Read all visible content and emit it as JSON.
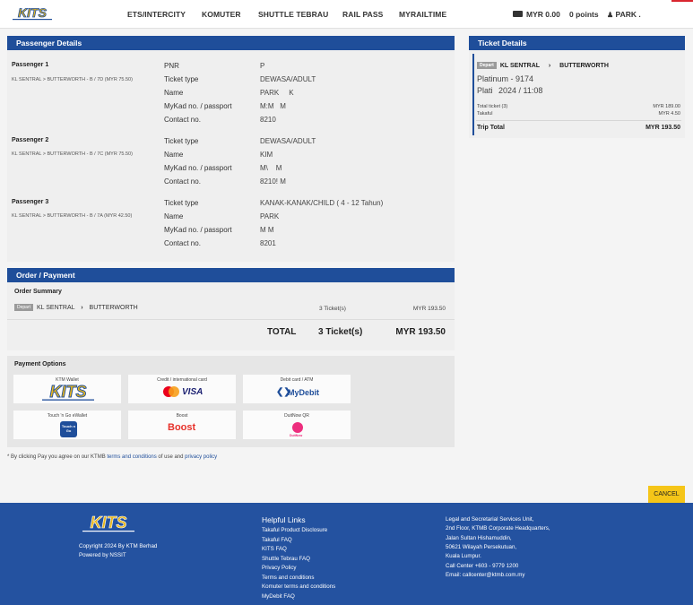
{
  "nav": {
    "logo_text": "KITS",
    "items": [
      "ETS/INTERCITY",
      "KOMUTER",
      "SHUTTLE TEBRAU",
      "RAIL PASS",
      "MYRAILTIME"
    ],
    "wallet": "MYR 0.00",
    "points": "0 points",
    "user": "PARK ."
  },
  "passenger_details": {
    "title": "Passenger Details",
    "passengers": [
      {
        "heading": "Passenger 1",
        "route": "KL SENTRAL > BUTTERWORTH - B / 7D (MYR 75.50)",
        "fields": [
          {
            "label": "PNR",
            "value": "P"
          },
          {
            "label": "Ticket type",
            "value": "DEWASA/ADULT"
          },
          {
            "label": "Name",
            "value": "PARK     K"
          },
          {
            "label": "MyKad no. / passport",
            "value": "M:M   M"
          },
          {
            "label": "Contact no.",
            "value": "8210"
          }
        ]
      },
      {
        "heading": "Passenger 2",
        "route": "KL SENTRAL > BUTTERWORTH - B / 7C (MYR 75.50)",
        "fields": [
          {
            "label": "Ticket type",
            "value": "DEWASA/ADULT"
          },
          {
            "label": "Name",
            "value": "KIM"
          },
          {
            "label": "MyKad no. / passport",
            "value": "M\\    M"
          },
          {
            "label": "Contact no.",
            "value": "8210! M"
          }
        ]
      },
      {
        "heading": "Passenger 3",
        "route": "KL SENTRAL > BUTTERWORTH - B / 7A (MYR 42.50)",
        "fields": [
          {
            "label": "Ticket type",
            "value": "KANAK-KANAK/CHILD ( 4 - 12 Tahun)"
          },
          {
            "label": "Name",
            "value": "PARK"
          },
          {
            "label": "MyKad no. / passport",
            "value": "M M"
          },
          {
            "label": "Contact no.",
            "value": "8201"
          }
        ]
      }
    ]
  },
  "order": {
    "title": "Order / Payment",
    "summary_title": "Order Summary",
    "badge": "Depart",
    "route_from": "KL SENTRAL",
    "route_to": "BUTTERWORTH",
    "line_tickets": "3 Ticket(s)",
    "line_amount": "MYR 193.50",
    "total_label": "TOTAL",
    "total_tickets": "3 Ticket(s)",
    "total_amount": "MYR 193.50"
  },
  "payment": {
    "title": "Payment Options",
    "options": [
      {
        "caption": "KTM Wallet",
        "logo": "KITS"
      },
      {
        "caption": "Credit / international card",
        "logo": "VISA"
      },
      {
        "caption": "Debit card / ATM",
        "logo": "MyDebit"
      },
      {
        "caption": "Touch 'n Go eWallet",
        "logo": "Touch n Go"
      },
      {
        "caption": "Boost",
        "logo": "Boost"
      },
      {
        "caption": "DuitNow QR",
        "logo": "DuitNow"
      }
    ],
    "disclaimer_pre": "* By clicking Pay you agree on our KTMB ",
    "disclaimer_link1": "terms and conditions",
    "disclaimer_mid": " of use and ",
    "disclaimer_link2": "privacy policy"
  },
  "ticket_details": {
    "title": "Ticket Details",
    "badge": "Depart",
    "from": "KL SENTRAL",
    "to": "BUTTERWORTH",
    "train": "Platinum - 9174",
    "date_prefix": "Plati",
    "date": "2024 / 11:08",
    "rows": [
      {
        "label": "Total ticket (3)",
        "value": "MYR 189.00"
      },
      {
        "label": "Takaful",
        "value": "MYR 4.50"
      }
    ],
    "trip_total_label": "Trip Total",
    "trip_total_value": "MYR 193.50"
  },
  "cancel_label": "CANCEL",
  "footer": {
    "copyright": "Copyright 2024 By KTM Berhad",
    "powered": "Powered by NSSIT",
    "links_title": "Helpful Links",
    "links": [
      "Takaful Product Disclosure",
      "Takaful FAQ",
      "KITS FAQ",
      "Shuttle Tebrau FAQ",
      "Privacy Policy",
      "Terms and conditions",
      "Komuter terms and conditions",
      "MyDebit FAQ"
    ],
    "address": [
      "Legal and Secretarial Services Unit,",
      "2nd Floor, KTMB Corporate Headquarters,",
      "Jalan Sultan Hishamuddin,",
      "50621 Wilayah Persekutuan,",
      "Kuala Lumpur.",
      "Call Center +603 - 9779 1200",
      "Email: callcenter@ktmb.com.my"
    ]
  },
  "colors": {
    "primary": "#1f4e9a",
    "footer": "#2452a0",
    "cancel": "#f5c518",
    "panel": "#efefef"
  }
}
